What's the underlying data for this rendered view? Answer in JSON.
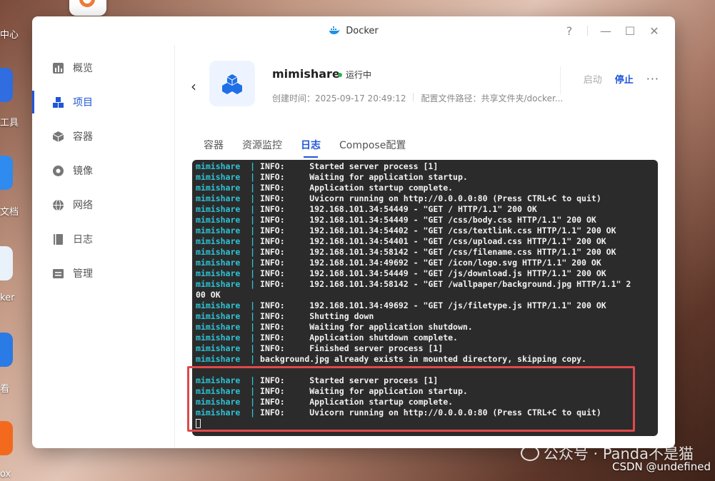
{
  "desktop": {
    "labels": [
      "中心",
      "工具",
      "文档",
      "ker",
      "看",
      "ox"
    ]
  },
  "window": {
    "title": "Docker",
    "controls": {
      "help": "?",
      "minimize": "—",
      "maximize": "☐",
      "close": "✕"
    }
  },
  "sidebar": {
    "items": [
      {
        "label": "概览",
        "icon": "chart-icon"
      },
      {
        "label": "项目",
        "icon": "cubes-icon"
      },
      {
        "label": "容器",
        "icon": "box-icon"
      },
      {
        "label": "镜像",
        "icon": "disc-icon"
      },
      {
        "label": "网络",
        "icon": "globe-icon"
      },
      {
        "label": "日志",
        "icon": "book-icon"
      },
      {
        "label": "管理",
        "icon": "list-icon"
      }
    ],
    "active_index": 1
  },
  "project": {
    "name": "mimishare",
    "status": "运行中",
    "created": "创建时间：2025-09-17 20:49:12",
    "config_path": "配置文件路径：共享文件夹/docker...",
    "start_label": "启动",
    "stop_label": "停止",
    "more_label": "···"
  },
  "tabs": [
    "容器",
    "资源监控",
    "日志",
    "Compose配置"
  ],
  "active_tab": 2,
  "log": {
    "service": "mimishare",
    "lines": [
      "INFO:     Started server process [1]",
      "INFO:     Waiting for application startup.",
      "INFO:     Application startup complete.",
      "INFO:     Uvicorn running on http://0.0.0.0:80 (Press CTRL+C to quit)",
      "INFO:     192.168.101.34:54449 - \"GET / HTTP/1.1\" 200 OK",
      "INFO:     192.168.101.34:54449 - \"GET /css/body.css HTTP/1.1\" 200 OK",
      "INFO:     192.168.101.34:54402 - \"GET /css/textlink.css HTTP/1.1\" 200 OK",
      "INFO:     192.168.101.34:54401 - \"GET /css/upload.css HTTP/1.1\" 200 OK",
      "INFO:     192.168.101.34:58142 - \"GET /css/filename.css HTTP/1.1\" 200 OK",
      "INFO:     192.168.101.34:49692 - \"GET /icon/logo.svg HTTP/1.1\" 200 OK",
      "INFO:     192.168.101.34:54449 - \"GET /js/download.js HTTP/1.1\" 200 OK",
      "INFO:     192.168.101.34:58142 - \"GET /wallpaper/background.jpg HTTP/1.1\" 2",
      "INFO:     192.168.101.34:49692 - \"GET /js/filetype.js HTTP/1.1\" 200 OK",
      "INFO:     Shutting down",
      "INFO:     Waiting for application shutdown.",
      "INFO:     Application shutdown complete.",
      "INFO:     Finished server process [1]",
      "background.jpg already exists in mounted directory, skipping copy.",
      "INFO:     Started server process [1]",
      "INFO:     Waiting for application startup.",
      "INFO:     Application startup complete.",
      "INFO:     Uvicorn running on http://0.0.0.0:80 (Press CTRL+C to quit)"
    ],
    "wrap_continuation": "00 OK"
  },
  "watermark": {
    "text": "公众号 · Panda不是猫",
    "csdn": "CSDN @undefined"
  },
  "colors": {
    "accent": "#1f56d8",
    "running": "#2bb24c",
    "terminal_bg": "#2b2b2b",
    "service_name": "#2dc3d6",
    "highlight_box": "#e0494b"
  }
}
